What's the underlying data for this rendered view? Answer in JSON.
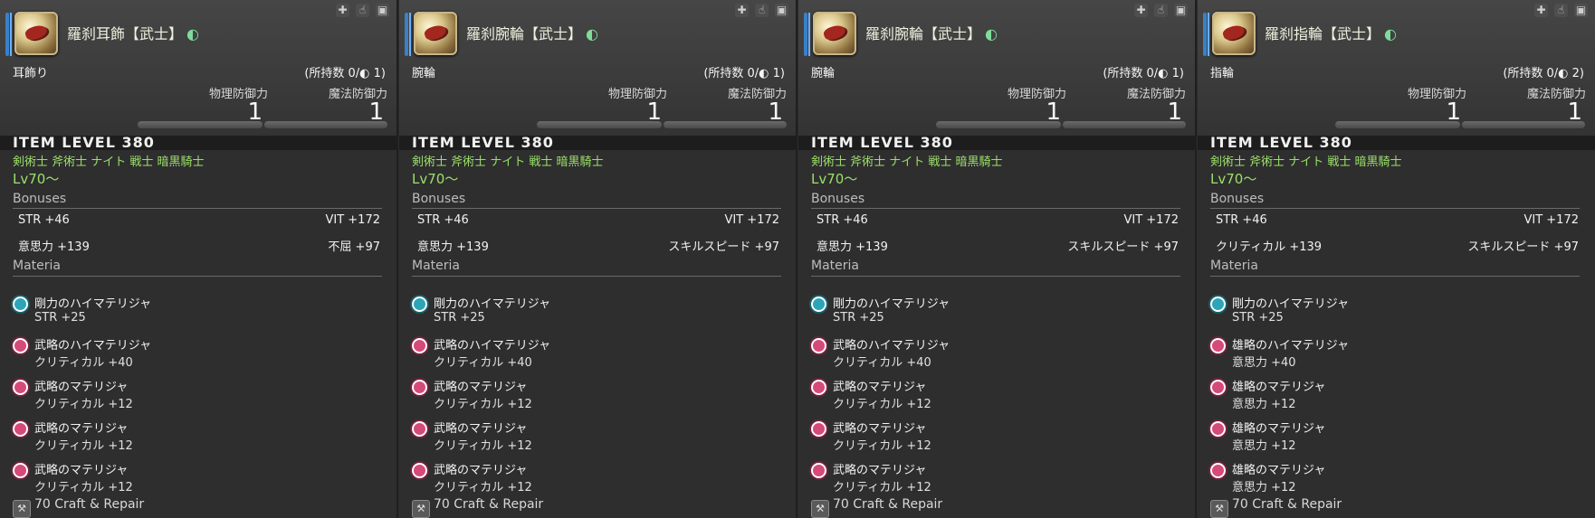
{
  "panels": [
    {
      "name": "羅刹耳飾【武士】",
      "type": "耳飾り",
      "owned": "(所持数 0/◐ 1)",
      "def_labels": {
        "phys": "物理防御力",
        "mag": "魔法防御力"
      },
      "def_values": {
        "phys": "1",
        "mag": "1"
      },
      "item_level": "ITEM LEVEL 380",
      "classes": "剣術士 斧術士 ナイト 戦士 暗黒騎士",
      "level": "Lv70〜",
      "bonuses_label": "Bonuses",
      "bonuses": [
        [
          "STR +46",
          "VIT +172"
        ],
        [
          "意思力 +139",
          "不屈 +97"
        ]
      ],
      "materia_label": "Materia",
      "materia": [
        {
          "name": "剛力のハイマテリジャ",
          "stat": "STR +25",
          "color": "teal"
        },
        {
          "name": "武略のハイマテリジャ",
          "stat": "クリティカル +40",
          "color": "pink"
        },
        {
          "name": "武略のマテリジャ",
          "stat": "クリティカル +12",
          "color": "pink"
        },
        {
          "name": "武略のマテリジャ",
          "stat": "クリティカル +12",
          "color": "pink"
        },
        {
          "name": "武略のマテリジャ",
          "stat": "クリティカル +12",
          "color": "pink"
        }
      ],
      "craft": "70 Craft & Repair"
    },
    {
      "name": "羅刹腕輪【武士】",
      "type": "腕輪",
      "owned": "(所持数 0/◐ 1)",
      "def_labels": {
        "phys": "物理防御力",
        "mag": "魔法防御力"
      },
      "def_values": {
        "phys": "1",
        "mag": "1"
      },
      "item_level": "ITEM LEVEL 380",
      "classes": "剣術士 斧術士 ナイト 戦士 暗黒騎士",
      "level": "Lv70〜",
      "bonuses_label": "Bonuses",
      "bonuses": [
        [
          "STR +46",
          "VIT +172"
        ],
        [
          "意思力 +139",
          "スキルスピード +97"
        ]
      ],
      "materia_label": "Materia",
      "materia": [
        {
          "name": "剛力のハイマテリジャ",
          "stat": "STR +25",
          "color": "teal"
        },
        {
          "name": "武略のハイマテリジャ",
          "stat": "クリティカル +40",
          "color": "pink"
        },
        {
          "name": "武略のマテリジャ",
          "stat": "クリティカル +12",
          "color": "pink"
        },
        {
          "name": "武略のマテリジャ",
          "stat": "クリティカル +12",
          "color": "pink"
        },
        {
          "name": "武略のマテリジャ",
          "stat": "クリティカル +12",
          "color": "pink"
        }
      ],
      "craft": "70 Craft & Repair"
    },
    {
      "name": "羅刹腕輪【武士】",
      "type": "腕輪",
      "owned": "(所持数 0/◐ 1)",
      "def_labels": {
        "phys": "物理防御力",
        "mag": "魔法防御力"
      },
      "def_values": {
        "phys": "1",
        "mag": "1"
      },
      "item_level": "ITEM LEVEL 380",
      "classes": "剣術士 斧術士 ナイト 戦士 暗黒騎士",
      "level": "Lv70〜",
      "bonuses_label": "Bonuses",
      "bonuses": [
        [
          "STR +46",
          "VIT +172"
        ],
        [
          "意思力 +139",
          "スキルスピード +97"
        ]
      ],
      "materia_label": "Materia",
      "materia": [
        {
          "name": "剛力のハイマテリジャ",
          "stat": "STR +25",
          "color": "teal"
        },
        {
          "name": "武略のハイマテリジャ",
          "stat": "クリティカル +40",
          "color": "pink"
        },
        {
          "name": "武略のマテリジャ",
          "stat": "クリティカル +12",
          "color": "pink"
        },
        {
          "name": "武略のマテリジャ",
          "stat": "クリティカル +12",
          "color": "pink"
        },
        {
          "name": "武略のマテリジャ",
          "stat": "クリティカル +12",
          "color": "pink"
        }
      ],
      "craft": "70 Craft & Repair"
    },
    {
      "name": "羅刹指輪【武士】",
      "type": "指輪",
      "owned": "(所持数 0/◐ 2)",
      "def_labels": {
        "phys": "物理防御力",
        "mag": "魔法防御力"
      },
      "def_values": {
        "phys": "1",
        "mag": "1"
      },
      "item_level": "ITEM LEVEL 380",
      "classes": "剣術士 斧術士 ナイト 戦士 暗黒騎士",
      "level": "Lv70〜",
      "bonuses_label": "Bonuses",
      "bonuses": [
        [
          "STR +46",
          "VIT +172"
        ],
        [
          "クリティカル +139",
          "スキルスピード +97"
        ]
      ],
      "materia_label": "Materia",
      "materia": [
        {
          "name": "剛力のハイマテリジャ",
          "stat": "STR +25",
          "color": "teal"
        },
        {
          "name": "雄略のハイマテリジャ",
          "stat": "意思力 +40",
          "color": "pink"
        },
        {
          "name": "雄略のマテリジャ",
          "stat": "意思力 +12",
          "color": "pink"
        },
        {
          "name": "雄略のマテリジャ",
          "stat": "意思力 +12",
          "color": "pink"
        },
        {
          "name": "雄略のマテリジャ",
          "stat": "意思力 +12",
          "color": "pink"
        }
      ],
      "craft": "70 Craft & Repair"
    }
  ],
  "hq_glyph": "◐",
  "icons": [
    "plus-icon",
    "hand-icon",
    "chest-icon",
    "craft-icon"
  ],
  "colors": {
    "accent": "#3a80c8",
    "class_text": "#9be06a",
    "teal_materia": "#2aa6b8",
    "pink_materia": "#d64a78"
  }
}
